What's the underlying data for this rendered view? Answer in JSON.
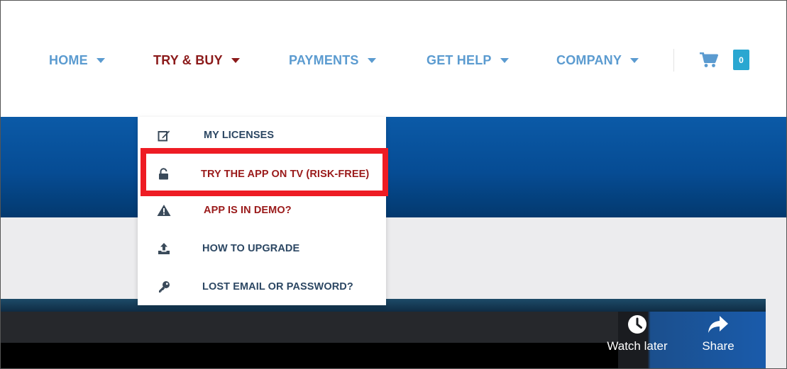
{
  "nav": {
    "items": [
      {
        "label": "HOME"
      },
      {
        "label": "TRY & BUY"
      },
      {
        "label": "PAYMENTS"
      },
      {
        "label": "GET HELP"
      },
      {
        "label": "COMPANY"
      }
    ],
    "active_index": 1,
    "cart_count": "0"
  },
  "dropdown": {
    "items": [
      {
        "label": "MY LICENSES",
        "icon": "edit-icon"
      },
      {
        "label": "TRY THE APP ON TV (RISK-FREE)",
        "icon": "unlock-icon",
        "highlighted": true
      },
      {
        "label": "APP IS IN DEMO?",
        "icon": "warning-icon"
      },
      {
        "label": "HOW TO UPGRADE",
        "icon": "upload-icon"
      },
      {
        "label": "LOST EMAIL OR PASSWORD?",
        "icon": "key-icon"
      }
    ]
  },
  "video": {
    "watch_later": "Watch later",
    "share": "Share"
  },
  "colors": {
    "nav_link": "#5b9bd0",
    "nav_active": "#8b1a1a",
    "banner_blue": "#064c94",
    "badge": "#2aa7d1",
    "highlight": "#ee1c24",
    "dropdown_text": "#2c4763",
    "dropdown_red_text": "#9a1a1a"
  }
}
